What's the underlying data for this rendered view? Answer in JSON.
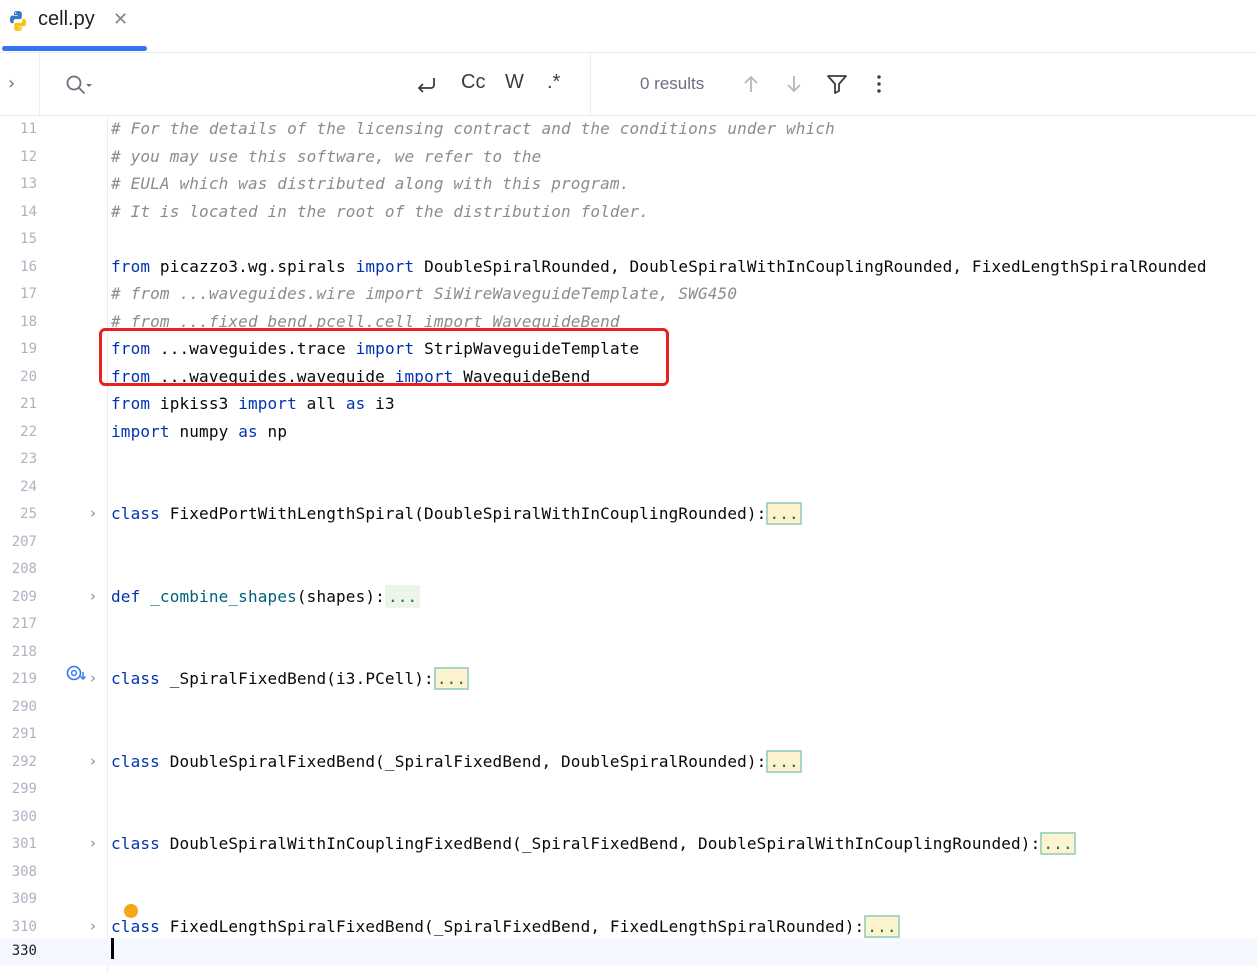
{
  "tab": {
    "title": "cell.py",
    "close": "✕",
    "active": true
  },
  "search": {
    "placeholder": "",
    "value": "",
    "options": {
      "preserve_case": "⟲",
      "match_case": "Cc",
      "words": "W",
      "regex": ".*"
    },
    "results": "0 results"
  },
  "editor": {
    "current_line": "330",
    "lines": [
      {
        "n": "11"
      },
      {
        "n": "12"
      },
      {
        "n": "13"
      },
      {
        "n": "14"
      },
      {
        "n": "15"
      },
      {
        "n": "16"
      },
      {
        "n": "17"
      },
      {
        "n": "18"
      },
      {
        "n": "19"
      },
      {
        "n": "20"
      },
      {
        "n": "21"
      },
      {
        "n": "22"
      },
      {
        "n": "23"
      },
      {
        "n": "24"
      },
      {
        "n": "25"
      },
      {
        "n": "207"
      },
      {
        "n": "208"
      },
      {
        "n": "209"
      },
      {
        "n": "217"
      },
      {
        "n": "218"
      },
      {
        "n": "219"
      },
      {
        "n": "290"
      },
      {
        "n": "291"
      },
      {
        "n": "292"
      },
      {
        "n": "299"
      },
      {
        "n": "300"
      },
      {
        "n": "301"
      },
      {
        "n": "308"
      },
      {
        "n": "309"
      },
      {
        "n": "310"
      },
      {
        "n": "330"
      }
    ],
    "code": {
      "l11": "# For the details of the licensing contract and the conditions under which",
      "l12": "# you may use this software, we refer to the",
      "l13": "# EULA which was distributed along with this program.",
      "l14": "# It is located in the root of the distribution folder.",
      "l16": {
        "k1": "from",
        "m1": " picazzo3.wg.spirals ",
        "k2": "import",
        "m2": " DoubleSpiralRounded, DoubleSpiralWithInCouplingRounded, FixedLengthSpiralRounded"
      },
      "l17": "# from ...waveguides.wire import SiWireWaveguideTemplate, SWG450",
      "l18": "# from ...fixed_bend.pcell.cell import WaveguideBend",
      "l19": {
        "k1": "from",
        "m1": " ...waveguides.trace ",
        "k2": "import",
        "m2": " StripWaveguideTemplate"
      },
      "l20": {
        "k1": "from",
        "m1": " ...waveguides.waveguide ",
        "k2": "import",
        "m2": " WaveguideBend"
      },
      "l21": {
        "k1": "from",
        "m1": " ipkiss3 ",
        "k2": "import",
        "m2": " all ",
        "k3": "as",
        "m3": " i3"
      },
      "l22": {
        "k1": "import",
        "m1": " numpy ",
        "k2": "as",
        "m2": " np"
      },
      "l25": {
        "k1": "class",
        "m1": " FixedPortWithLengthSpiral(DoubleSpiralWithInCouplingRounded):",
        "dots": "..."
      },
      "l209": {
        "k1": "def",
        "fn": " _combine_shapes",
        "m1": "(shapes):",
        "dots": "..."
      },
      "l219": {
        "k1": "class",
        "m1": " _SpiralFixedBend(i3.PCell):",
        "dots": "..."
      },
      "l292": {
        "k1": "class",
        "m1": " DoubleSpiralFixedBend(_SpiralFixedBend, DoubleSpiralRounded):",
        "dots": "..."
      },
      "l301": {
        "k1": "class",
        "m1": " DoubleSpiralWithInCouplingFixedBend(_SpiralFixedBend, DoubleSpiralWithInCouplingRounded):",
        "dots": "..."
      },
      "l310": {
        "k1": "class",
        "m1": " FixedLengthSpiralFixedBend(_SpiralFixedBend, FixedLengthSpiralRounded):",
        "dots": "..."
      }
    },
    "fold_glyph": "›"
  },
  "colors": {
    "keyword": "#0033b3",
    "comment": "#8c8c8c",
    "function": "#00627a",
    "highlight_box": "#e8221a",
    "tab_underline": "#3574f0"
  }
}
